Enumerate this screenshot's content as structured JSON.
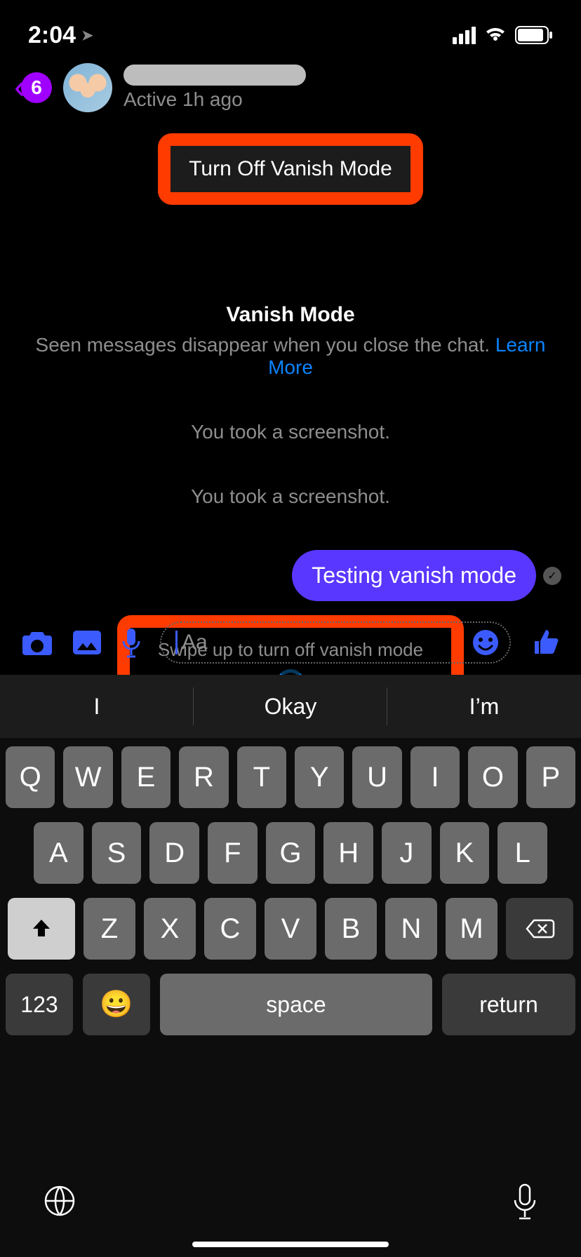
{
  "status": {
    "time": "2:04"
  },
  "header": {
    "back_badge": "6",
    "active_text": "Active 1h ago"
  },
  "vanish_button": {
    "label": "Turn Off Vanish Mode"
  },
  "vanish_info": {
    "title": "Vanish Mode",
    "desc": "Seen messages disappear when you close the chat. ",
    "learn": "Learn More"
  },
  "system_msgs": {
    "s1": "You took a screenshot.",
    "s2": "You took a screenshot."
  },
  "message": {
    "text": "Testing vanish mode"
  },
  "swipe": {
    "text": "Swipe up to turn off vanish mode"
  },
  "composer": {
    "placeholder": "Aa"
  },
  "suggestions": {
    "a": "I",
    "b": "Okay",
    "c": "I’m"
  },
  "keys": {
    "r1": {
      "k0": "Q",
      "k1": "W",
      "k2": "E",
      "k3": "R",
      "k4": "T",
      "k5": "Y",
      "k6": "U",
      "k7": "I",
      "k8": "O",
      "k9": "P"
    },
    "r2": {
      "k0": "A",
      "k1": "S",
      "k2": "D",
      "k3": "F",
      "k4": "G",
      "k5": "H",
      "k6": "J",
      "k7": "K",
      "k8": "L"
    },
    "r3": {
      "k0": "Z",
      "k1": "X",
      "k2": "C",
      "k3": "V",
      "k4": "B",
      "k5": "N",
      "k6": "M"
    },
    "numbers": "123",
    "space": "space",
    "ret": "return",
    "emoji": "😀"
  }
}
